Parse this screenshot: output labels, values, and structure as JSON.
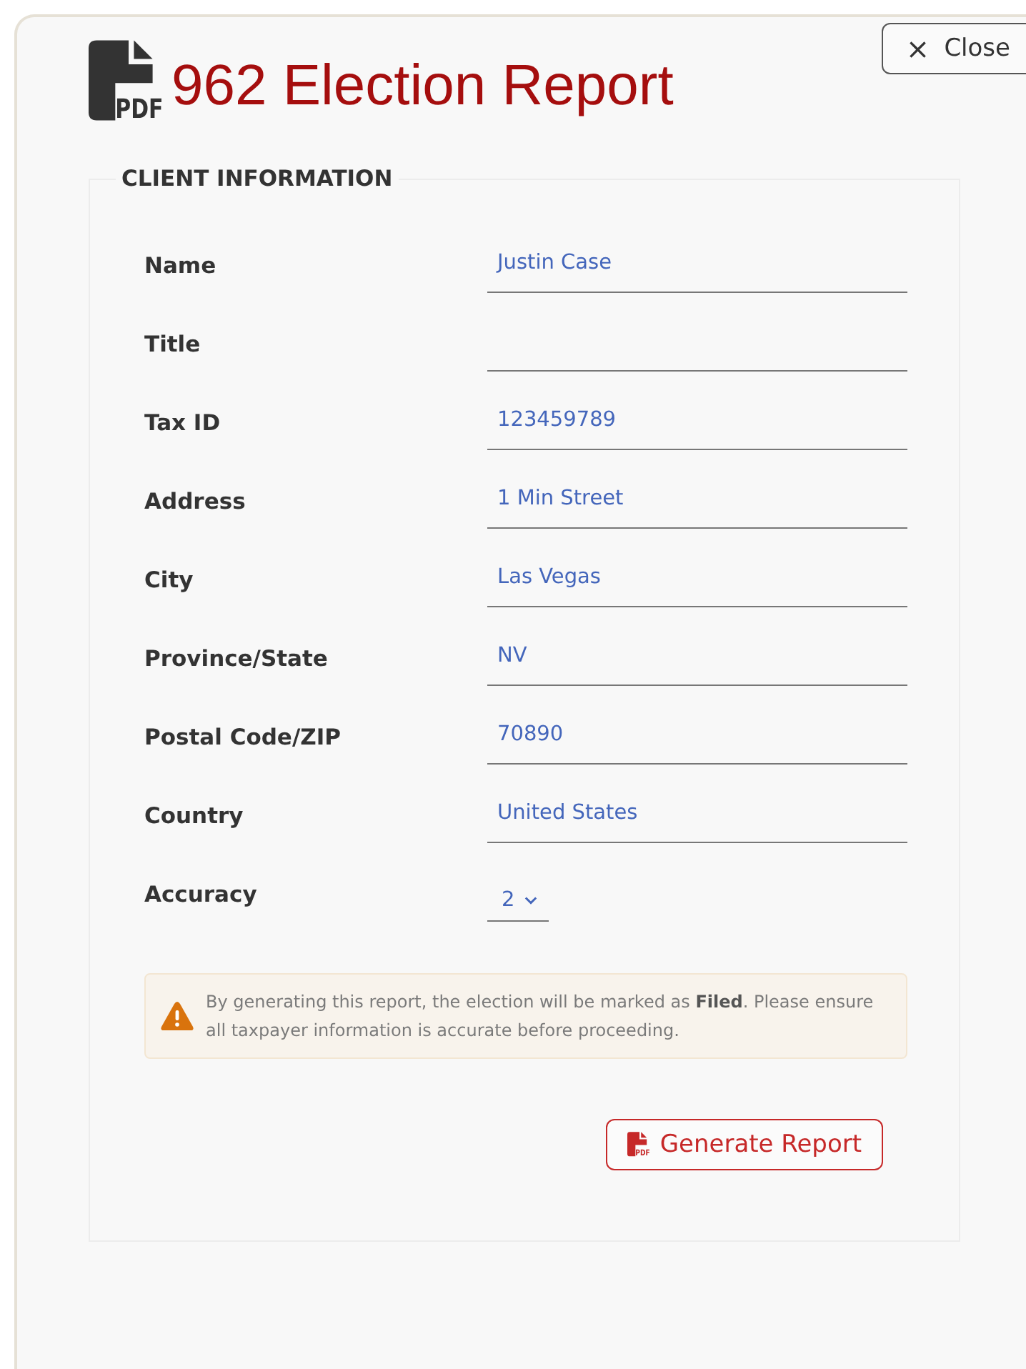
{
  "header": {
    "icon_label": "PDF",
    "title": "962 Election Report",
    "close_button": {
      "icon": "×",
      "label": "Close"
    }
  },
  "client_information": {
    "legend": "CLIENT INFORMATION",
    "fields": [
      {
        "kind": "text",
        "label": "Name",
        "value": "Justin Case"
      },
      {
        "kind": "text",
        "label": "Title"
      },
      {
        "kind": "text",
        "label": "Tax ID",
        "value": "123459789"
      },
      {
        "kind": "text",
        "label": "Address",
        "value": "1 Min Street"
      },
      {
        "kind": "text",
        "label": "City",
        "value": "Las Vegas"
      },
      {
        "kind": "text",
        "label": "Province/State",
        "value": "NV"
      },
      {
        "kind": "text",
        "label": "Postal Code/ZIP",
        "value": "70890"
      },
      {
        "kind": "text",
        "label": "Country",
        "value": "United States"
      },
      {
        "kind": "select",
        "label": "Accuracy",
        "value": "2"
      }
    ],
    "warning": "By generating this report, the election will be marked as **Filed**. Please ensure all taxpayer information is accurate before proceeding.",
    "generate_button": {
      "icon_label": "PDF",
      "label": "Generate Report"
    }
  }
}
